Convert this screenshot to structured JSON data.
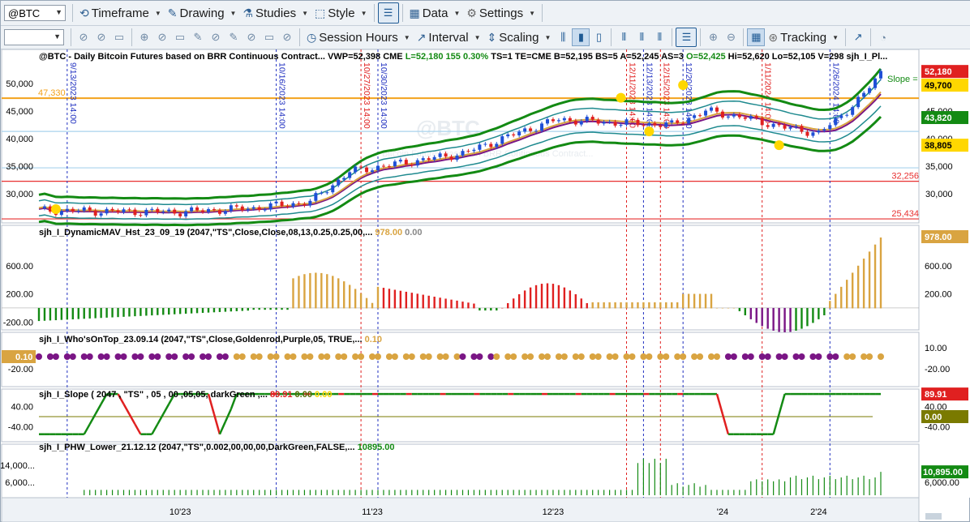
{
  "toolbar1": {
    "symbol": "@BTC",
    "timeframe": "Timeframe",
    "drawing": "Drawing",
    "studies": "Studies",
    "style": "Style",
    "data": "Data",
    "settings": "Settings"
  },
  "toolbar2": {
    "session_hours": "Session Hours",
    "interval": "Interval",
    "scaling": "Scaling",
    "tracking": "Tracking"
  },
  "colors": {
    "toolbar_bg": "#eef2f6",
    "up_bar": "#1f4fd6",
    "down_bar": "#e02020",
    "green": "#138a13",
    "goldenrod": "#d9a441",
    "purple": "#7a1585",
    "hline": "#e83030",
    "orange": "#f3a21b",
    "teal": "#1f8a8f"
  },
  "chart_data": {
    "type": "line",
    "x_ticks": [
      "10'23",
      "11'23",
      "12'23",
      "'24",
      "2'24"
    ],
    "vertical_markers": [
      {
        "label": "9/13/2023 14:00",
        "color": "blue"
      },
      {
        "label": "10/16/2023 14:00",
        "color": "blue"
      },
      {
        "label": "10/27/2023 14:00",
        "color": "red"
      },
      {
        "label": "10/30/2023 14:00",
        "color": "blue"
      },
      {
        "label": "12/11/2023 14:00",
        "color": "red"
      },
      {
        "label": "12/13/2023 14:00",
        "color": "blue"
      },
      {
        "label": "12/15/2023 14:00",
        "color": "red"
      },
      {
        "label": "12/20/2023 14:00",
        "color": "blue"
      },
      {
        "label": "1/11/2024 14:00",
        "color": "red"
      },
      {
        "label": "1/26/2024 14:00",
        "color": "blue"
      }
    ],
    "price_pane": {
      "title": "@BTC - Daily  Bitcoin Futures based on BRR Continuous Contract...  VWP=52,398  CME",
      "stats": [
        {
          "text": "L=52,180",
          "color": "#138a13"
        },
        {
          "text": "155",
          "color": "#138a13"
        },
        {
          "text": "0.30%",
          "color": "#138a13"
        },
        {
          "text": "TS=1",
          "color": "#000000"
        },
        {
          "text": "TE=CME",
          "color": "#000000"
        },
        {
          "text": "B=52,195",
          "color": "#000000"
        },
        {
          "text": "BS=5",
          "color": "#000000"
        },
        {
          "text": "A=52,245",
          "color": "#000000"
        },
        {
          "text": "AS=3",
          "color": "#000000"
        },
        {
          "text": "O=52,425",
          "color": "#138a13"
        },
        {
          "text": "Hi=52,620",
          "color": "#000000"
        },
        {
          "text": "Lo=52,105",
          "color": "#000000"
        },
        {
          "text": "V=298",
          "color": "#000000"
        },
        {
          "text": "sjh_I_Pl...",
          "color": "#000000"
        }
      ],
      "y_ticks": [
        "50,000",
        "45,000",
        "40,000",
        "35,000",
        "30,000"
      ],
      "ylim": [
        25000,
        55000
      ],
      "price_labels": [
        {
          "value": "52,180",
          "bg": "#e02020",
          "fg": "#ffffff",
          "price": 52180
        },
        {
          "value": "49,700",
          "bg": "#ffd700",
          "fg": "#000000",
          "price": 49700
        },
        {
          "value": "43,820",
          "bg": "#138a13",
          "fg": "#ffffff",
          "price": 43820
        },
        {
          "value": "38,805",
          "bg": "#ffd700",
          "fg": "#000000",
          "price": 38805
        }
      ],
      "hlines": [
        {
          "price": 47330,
          "label": "47,330",
          "color": "#f3a21b"
        },
        {
          "price": 32256,
          "label": "32,256",
          "color": "#e83030"
        },
        {
          "price": 25434,
          "label": "25,434",
          "color": "#e83030"
        },
        {
          "price": 41300,
          "label": "",
          "color": "#a9d3ee"
        },
        {
          "price": 34700,
          "label": "",
          "color": "#a9d3ee"
        }
      ],
      "slope_label": "Slope =",
      "watermark": "@BTC",
      "watermark_sub": "Bitcoin Futures based on BRR Continuous Contract..."
    },
    "panes": [
      {
        "name": "sjh_I_DynamicMAV_Hst_23_09_19 (2047,\"TS\",Close,Close,08,13,0.25,0.25,00,...",
        "values": [
          {
            "text": "978.00",
            "color": "#d9a441"
          },
          {
            "text": "0.00",
            "color": "#888888"
          }
        ],
        "y_ticks": [
          "600.00",
          "200.00",
          "-200.00"
        ],
        "ylim": [
          -300,
          1000
        ],
        "last_label": {
          "text": "978.00",
          "bg": "#d9a441",
          "fg": "#ffffff"
        }
      },
      {
        "name": "sjh_I_Who'sOnTop_23.09.14 (2047,\"TS\",Close,Goldenrod,Purple,05,  TRUE,...",
        "values": [
          {
            "text": "0.10",
            "color": "#d9a441"
          }
        ],
        "y_ticks": [
          "10.00",
          "-20.00"
        ],
        "ylim": [
          -30,
          20
        ],
        "left_label": {
          "text": "0.10",
          "bg": "#d9a441",
          "fg": "#ffffff"
        }
      },
      {
        "name": "sjh_I_Slope ( 2047 , \"TS\" , 05 , 00 ,05,05, darkGreen ,...",
        "values": [
          {
            "text": "89.91",
            "color": "#e02020"
          },
          {
            "text": "0.00",
            "color": "#556b00"
          },
          {
            "text": "0.00",
            "color": "#ffd700"
          }
        ],
        "y_ticks": [
          "40.00",
          "-40.00"
        ],
        "ylim": [
          -100,
          100
        ],
        "labels": [
          {
            "text": "89.91",
            "bg": "#e02020",
            "fg": "#ffffff",
            "value": 89.91
          },
          {
            "text": "0.00",
            "bg": "#7a7a00",
            "fg": "#ffffff",
            "value": 0
          }
        ]
      },
      {
        "name": "sjh_I_PHW_Lower_21.12.12 (2047,\"TS\",0.002,00,00,00,DarkGreen,FALSE,...",
        "values": [
          {
            "text": "10895.00",
            "color": "#138a13"
          }
        ],
        "y_ticks": [
          "14,000...",
          "6,000..."
        ],
        "right_ticks": [
          "6,000.00"
        ],
        "ylim": [
          0,
          20000
        ],
        "last_label": {
          "text": "10,895.00",
          "bg": "#138a13",
          "fg": "#ffffff"
        }
      }
    ]
  }
}
